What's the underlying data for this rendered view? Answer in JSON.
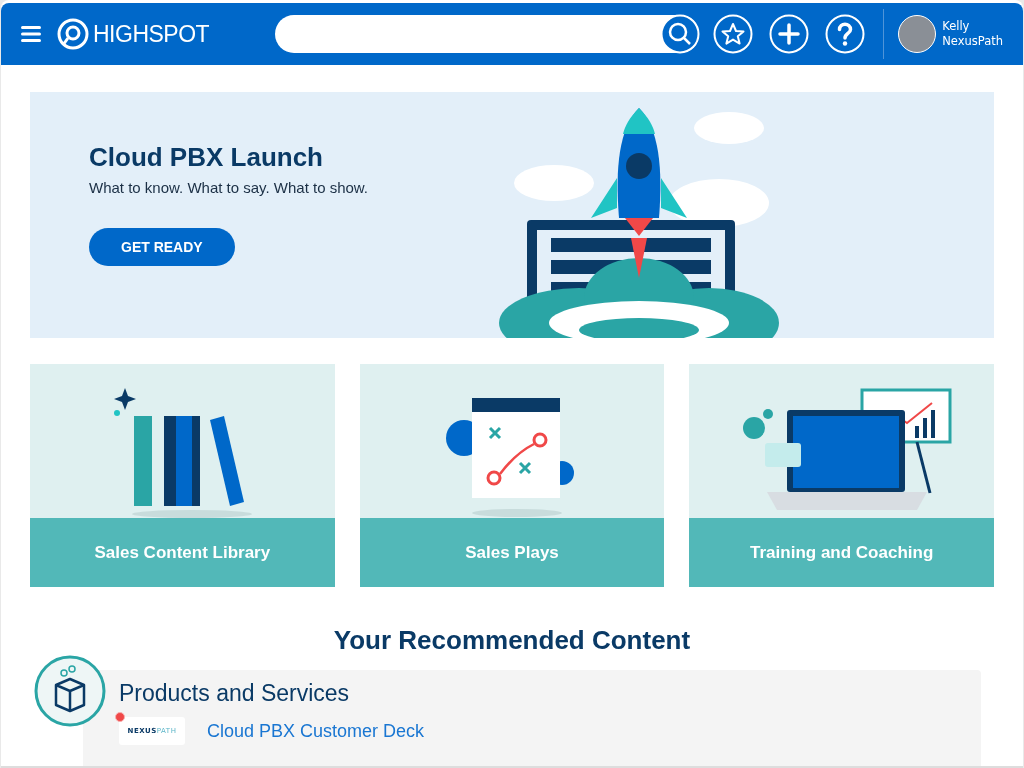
{
  "header": {
    "logo": "HIGHSPOT",
    "user": {
      "first_name": "Kelly",
      "last_name": "NexusPath"
    }
  },
  "banner": {
    "title": "Cloud PBX Launch",
    "subtitle": "What to know. What to say. What to show.",
    "button": "GET READY"
  },
  "cards": [
    {
      "kind": "books",
      "label": "Sales Content Library"
    },
    {
      "kind": "plays",
      "label": "Sales Plays"
    },
    {
      "kind": "training",
      "label": "Training and Coaching"
    }
  ],
  "recommended": {
    "heading": "Your Recommended Content",
    "section": {
      "title": "Products and Services",
      "items": [
        {
          "logo": "**NEXUS**PATH",
          "title": "Cloud PBX Customer Deck",
          "new": true
        }
      ]
    }
  }
}
